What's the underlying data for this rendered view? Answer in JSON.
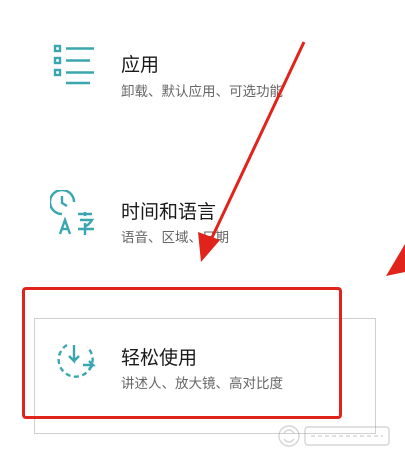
{
  "settings": {
    "apps": {
      "title": "应用",
      "description": "卸载、默认应用、可选功能",
      "icon": "apps-list-icon"
    },
    "time_language": {
      "title": "时间和语言",
      "description": "语音、区域、日期",
      "icon": "time-language-icon"
    },
    "ease_of_access": {
      "title": "轻松使用",
      "description": "讲述人、放大镜、高对比度",
      "icon": "ease-of-access-icon"
    }
  },
  "annotation": {
    "highlight_color": "#e0231b"
  },
  "theme": {
    "icon_color": "#3aa6b0"
  }
}
